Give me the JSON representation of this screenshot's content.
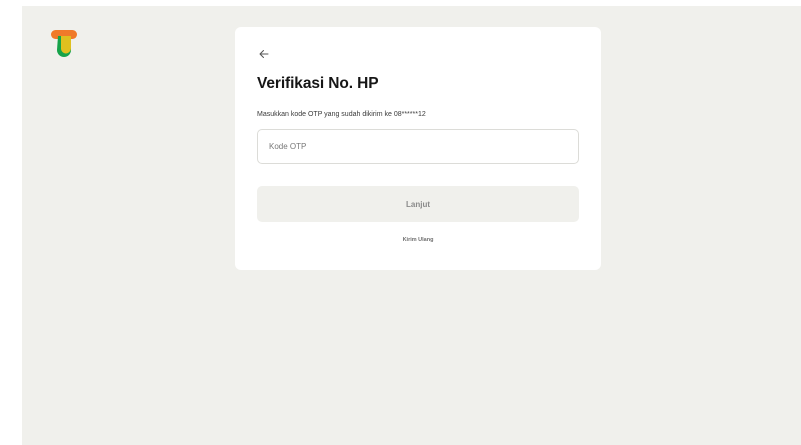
{
  "colors": {
    "page_background": "#f0f0ec",
    "card_background": "#ffffff",
    "logo_orange": "#f07a2a",
    "logo_green": "#16a34a",
    "logo_yellow": "#f5c31b",
    "button_disabled_bg": "#f0f0ec"
  },
  "logo": {
    "icon": "app-logo-icon"
  },
  "card": {
    "back_icon": "arrow-left-icon",
    "title": "Verifikasi No. HP",
    "subtitle": "Masukkan kode OTP yang sudah dikirim ke 08******12",
    "otp_input": {
      "placeholder": "Kode OTP",
      "value": ""
    },
    "submit_label": "Lanjut",
    "submit_disabled": true,
    "resend_label": "Kirim Ulang"
  }
}
